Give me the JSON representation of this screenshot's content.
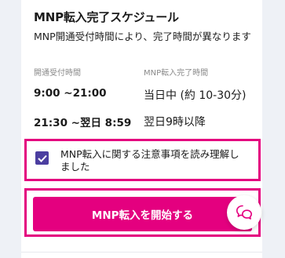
{
  "schedule": {
    "title": "MNP転入完了スケジュール",
    "description": "MNP開通受付時間により、完了時間が異なります",
    "headers": {
      "start": "開通受付時間",
      "end": "MNP転入完了時間"
    },
    "rows": [
      {
        "start": "9:00 ~21:00",
        "end": "当日中 (約 10-30分)"
      },
      {
        "start": "21:30 ~翌日 8:59",
        "end": "翌日9時以降"
      }
    ]
  },
  "agreement": {
    "label": "MNP転入に関する注意事項を読み理解しました",
    "checked": true
  },
  "cta": {
    "label": "MNP転入を開始する"
  },
  "chat": {
    "icon": "chat-bubbles-icon"
  },
  "colors": {
    "accent": "#e4007f",
    "checkbox": "#4b3ea0"
  }
}
